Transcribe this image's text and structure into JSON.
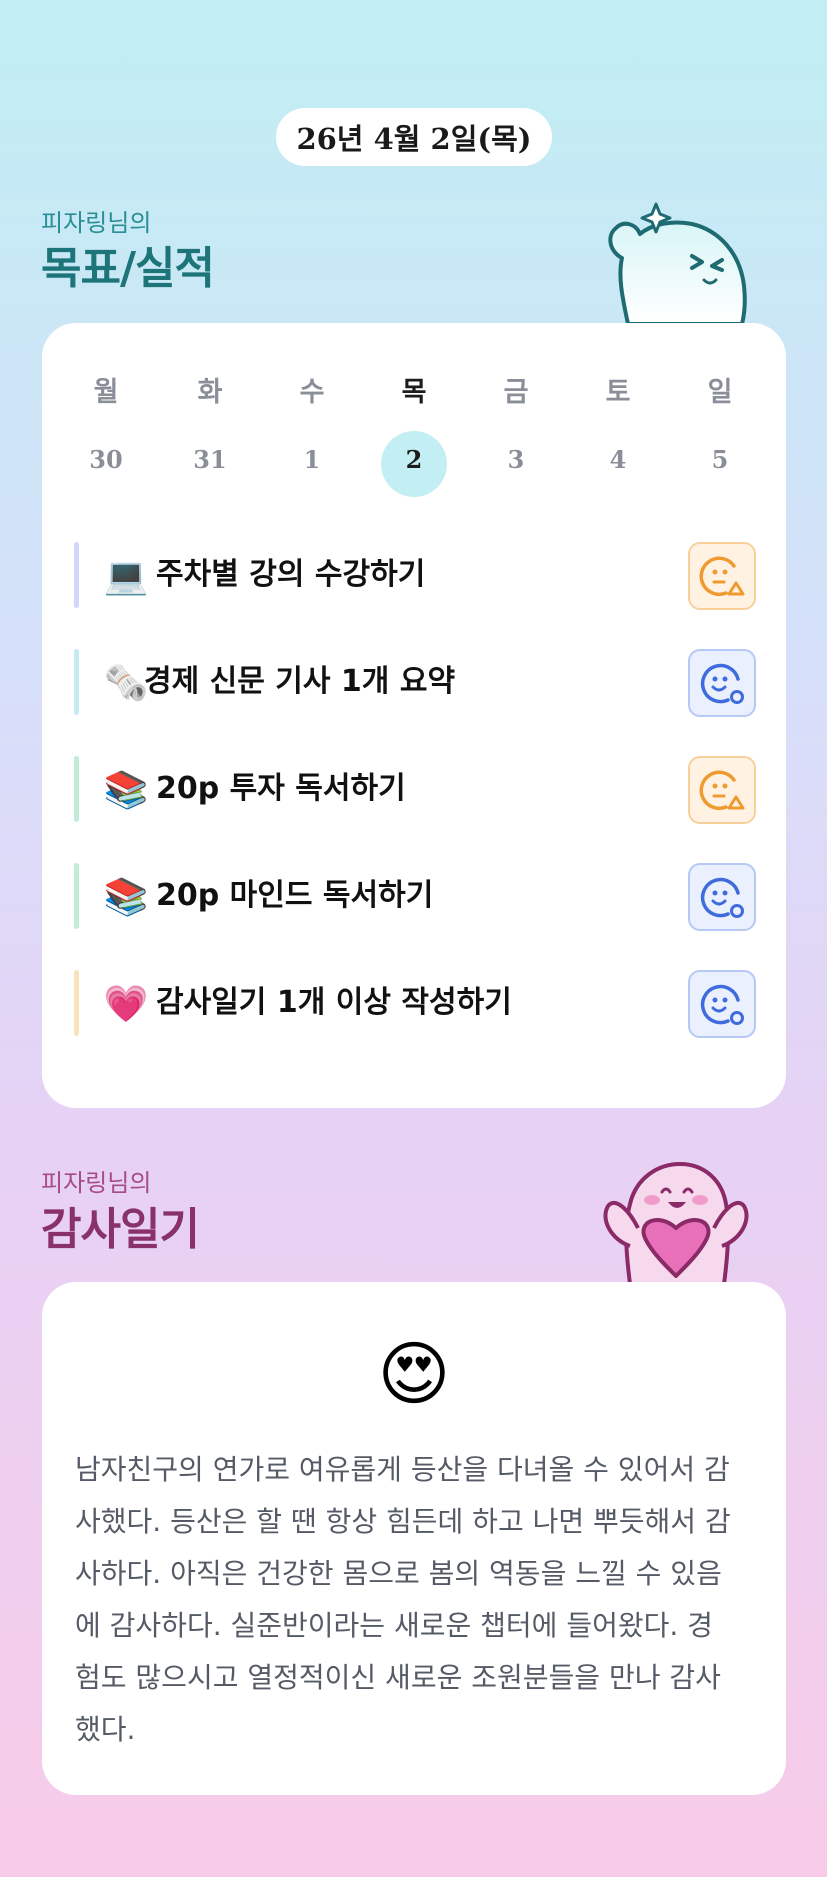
{
  "date": "26년 4월 2일(목)",
  "goals_section": {
    "subtitle": "피자링님의",
    "title": "목표/실적"
  },
  "week": {
    "days": [
      "월",
      "화",
      "수",
      "목",
      "금",
      "토",
      "일"
    ],
    "dates": [
      "30",
      "31",
      "1",
      "2",
      "3",
      "4",
      "5"
    ],
    "selected_index": 3
  },
  "goals": [
    {
      "emoji": "💻",
      "text": "주차별 강의 수강하기",
      "status": "partial-icon",
      "bar_color": "#cfd8fb"
    },
    {
      "emoji": "🗞️",
      "text": "경제 신문 기사 1개 요약",
      "status": "done-icon",
      "bar_color": "#c2ecf0"
    },
    {
      "emoji": "📚",
      "text": "20p  투자 독서하기",
      "status": "partial-icon",
      "bar_color": "#c2ecd8"
    },
    {
      "emoji": "📚",
      "text": "20p  마인드 독서하기",
      "status": "done-icon",
      "bar_color": "#c2ecd8"
    },
    {
      "emoji": "💗",
      "text": "감사일기 1개 이상 작성하기",
      "status": "done-icon",
      "bar_color": "#fbe2bd"
    }
  ],
  "gratitude_section": {
    "subtitle": "피자링님의",
    "title": "감사일기"
  },
  "gratitude": {
    "emoji": "😍",
    "text": "남자친구의 연가로 여유롭게 등산을 다녀올 수 있어서 감사했다. 등산은 할 땐 항상 힘든데 하고 나면 뿌듯해서 감사하다. 아직은 건강한 몸으로 봄의 역동을 느낄 수 있음에 감사하다. 실준반이라는 새로운 챕터에 들어왔다. 경험도 많으시고 열정적이신  새로운 조원분들을 만나 감사했다."
  },
  "colors": {
    "accent_teal": "#1d7479",
    "accent_pink": "#88316b",
    "status_partial": "#ef9a2e",
    "status_done": "#3f6bdc"
  }
}
